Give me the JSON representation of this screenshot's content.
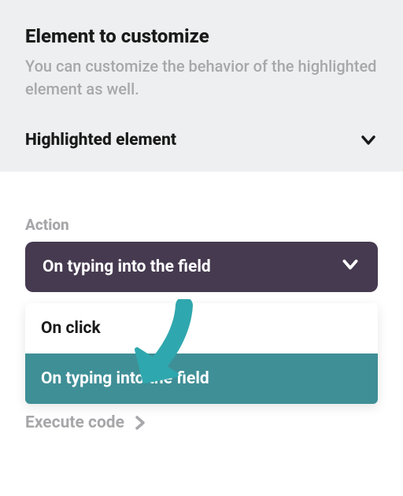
{
  "top": {
    "title": "Element to customize",
    "subtitle": "You can customize the behavior of the highlighted element as well.",
    "accordion_label": "Highlighted element"
  },
  "action": {
    "label": "Action",
    "selected": "On typing into the field",
    "options": [
      "On click",
      "On typing into the field"
    ]
  },
  "behind": {
    "label": "Execute code"
  },
  "colors": {
    "select_bg": "#463a50",
    "option_selected_bg": "#3f8f97",
    "annotation_arrow": "#2fa7ae"
  }
}
